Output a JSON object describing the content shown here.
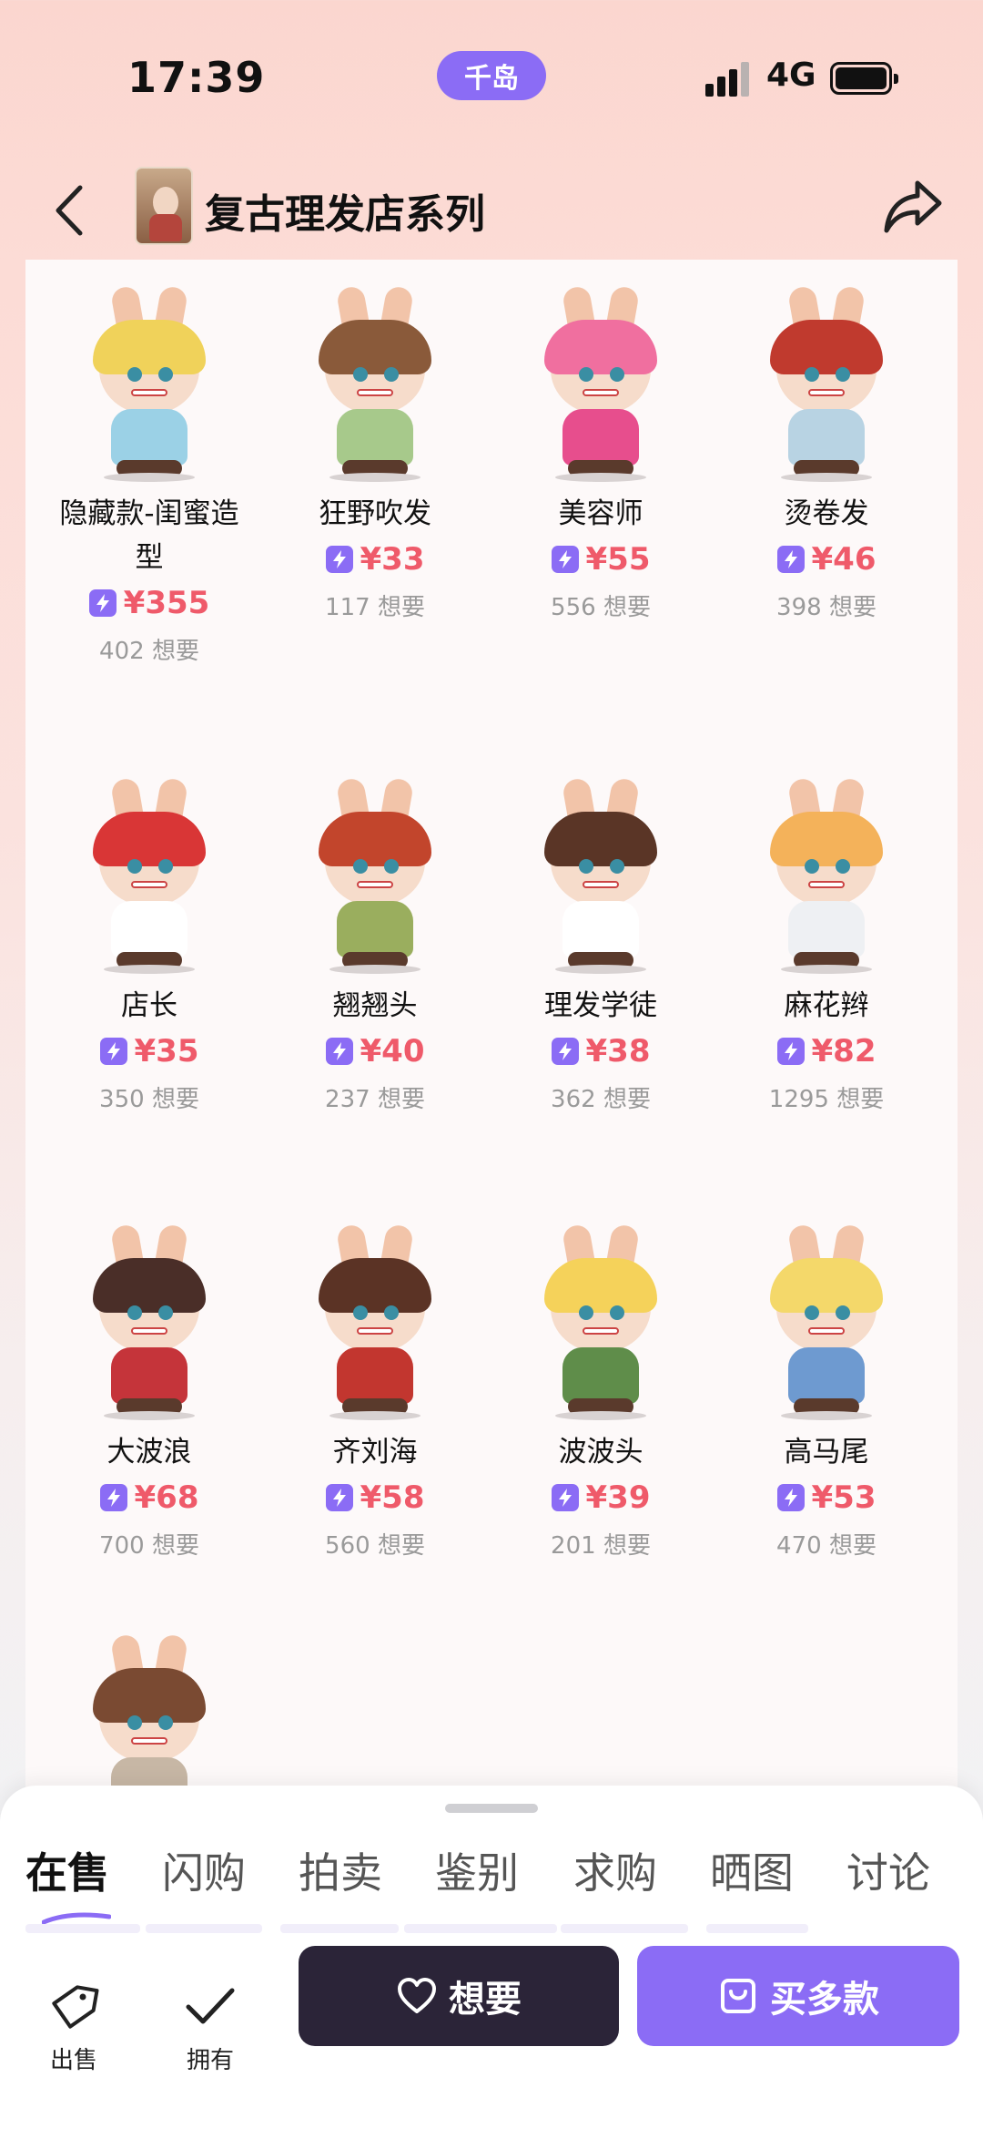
{
  "status": {
    "time": "17:39",
    "app_badge": "千岛",
    "network": "4G"
  },
  "header": {
    "title": "复古理发店系列"
  },
  "products": [
    {
      "name": "隐藏款-闺蜜造型",
      "price": "¥355",
      "want": "402 想要",
      "hair": "#f0d25a",
      "outfit": "#9bd1e6"
    },
    {
      "name": "狂野吹发",
      "price": "¥33",
      "want": "117 想要",
      "hair": "#8a5a3a",
      "outfit": "#a7c98b"
    },
    {
      "name": "美容师",
      "price": "¥55",
      "want": "556 想要",
      "hair": "#f06f9f",
      "outfit": "#e74e8d"
    },
    {
      "name": "烫卷发",
      "price": "¥46",
      "want": "398 想要",
      "hair": "#c03a2e",
      "outfit": "#b8d3e3"
    },
    {
      "name": "店长",
      "price": "¥35",
      "want": "350 想要",
      "hair": "#d93636",
      "outfit": "#ffffff"
    },
    {
      "name": "翘翘头",
      "price": "¥40",
      "want": "237 想要",
      "hair": "#c2452c",
      "outfit": "#9aae5e"
    },
    {
      "name": "理发学徒",
      "price": "¥38",
      "want": "362 想要",
      "hair": "#5a3526",
      "outfit": "#ffffff"
    },
    {
      "name": "麻花辫",
      "price": "¥82",
      "want": "1295 想要",
      "hair": "#f4b25a",
      "outfit": "#eef0f3"
    },
    {
      "name": "大波浪",
      "price": "¥68",
      "want": "700 想要",
      "hair": "#4a2e28",
      "outfit": "#c5343a"
    },
    {
      "name": "齐刘海",
      "price": "¥58",
      "want": "560 想要",
      "hair": "#5b3325",
      "outfit": "#c2362f"
    },
    {
      "name": "波波头",
      "price": "¥39",
      "want": "201 想要",
      "hair": "#f5d25a",
      "outfit": "#5f8d4a"
    },
    {
      "name": "高马尾",
      "price": "¥53",
      "want": "470 想要",
      "hair": "#f4d86a",
      "outfit": "#6e9ad0"
    },
    {
      "name": "",
      "price": "",
      "want": "",
      "hair": "#7a4a32",
      "outfit": "#c7b7a5"
    }
  ],
  "tabs": [
    "在售",
    "闪购",
    "拍卖",
    "鉴别",
    "求购",
    "晒图",
    "讨论"
  ],
  "actions": {
    "sell_label": "出售",
    "own_label": "拥有",
    "want_label": "想要",
    "multi_label": "买多款"
  },
  "colors": {
    "accent": "#8b6cf5",
    "price": "#ef5a6a",
    "dark_button": "#2b2438"
  },
  "icons": [
    "back-icon",
    "share-icon",
    "flash-icon",
    "tag-icon",
    "check-icon",
    "heart-icon",
    "bag-icon"
  ]
}
